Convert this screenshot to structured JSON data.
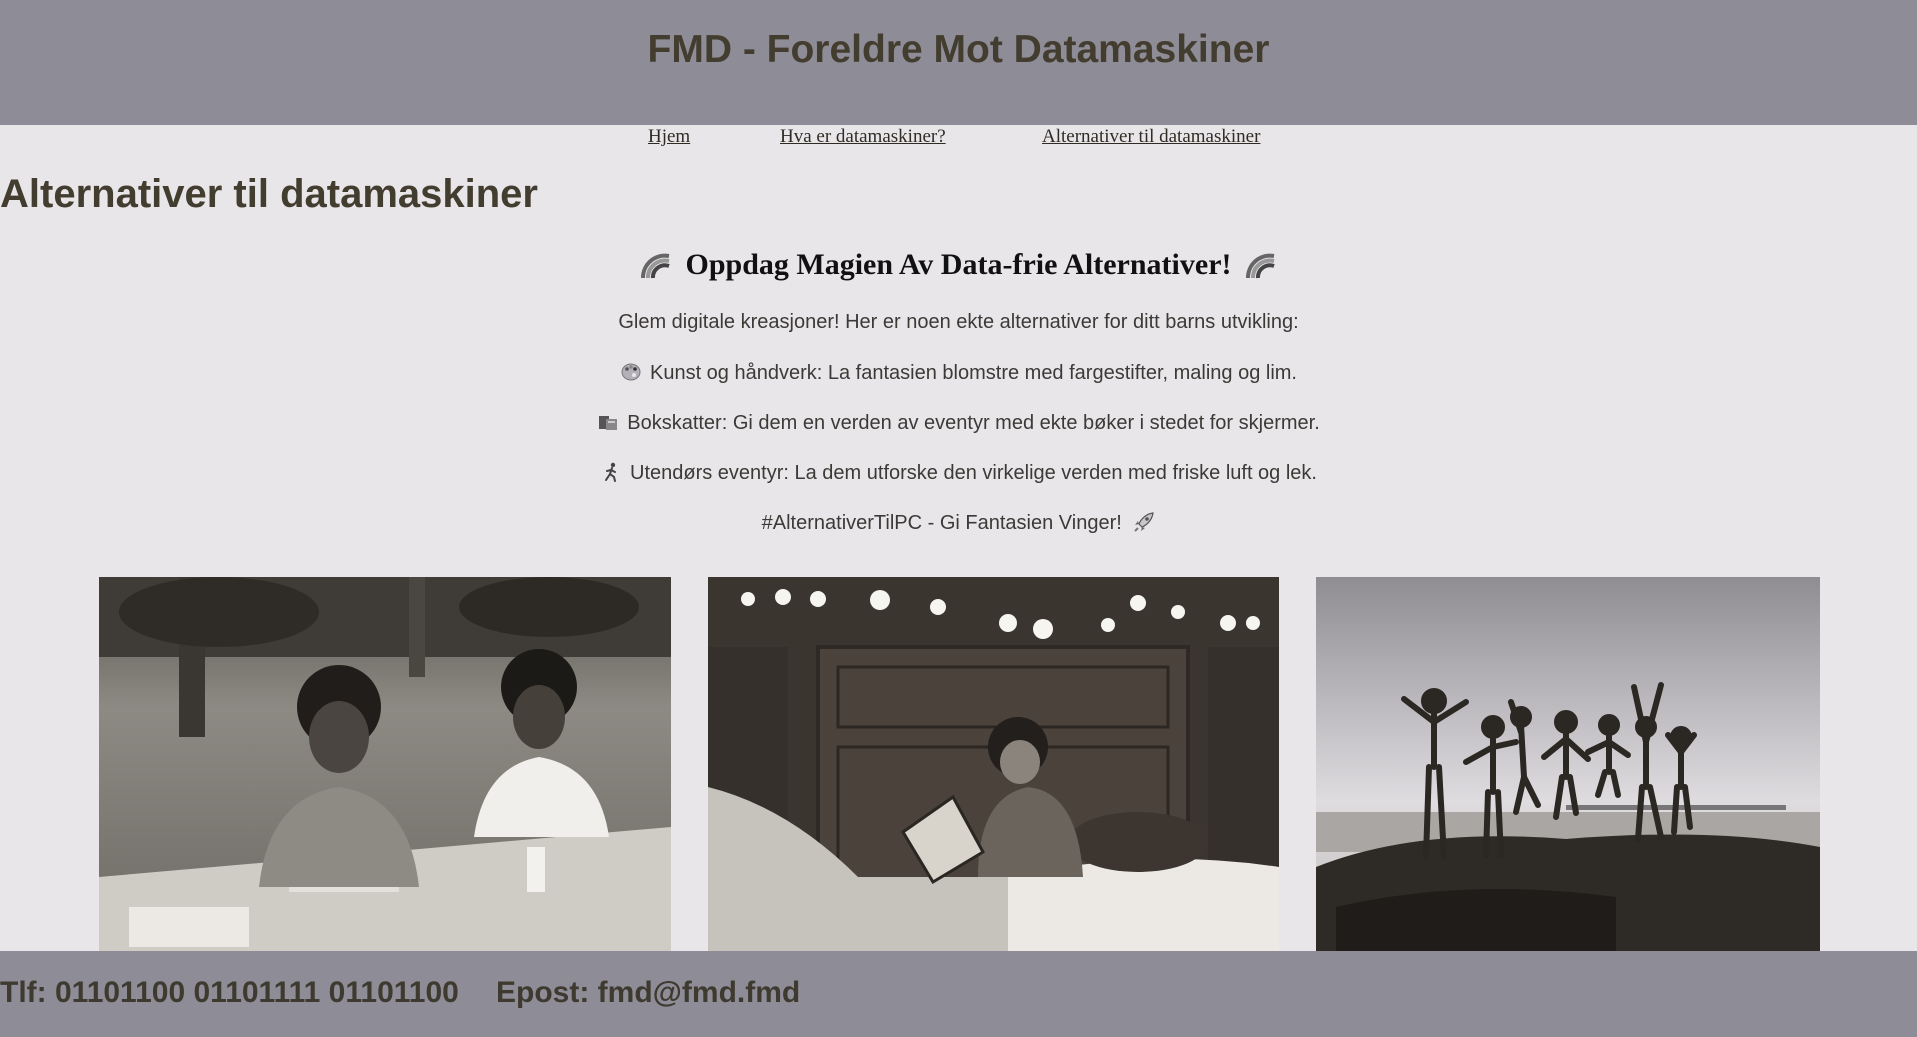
{
  "header": {
    "title": "FMD - Foreldre Mot Datamaskiner"
  },
  "nav": {
    "items": [
      {
        "label": "Hjem"
      },
      {
        "label": "Hva er datamaskiner?"
      },
      {
        "label": "Alternativer til datamaskiner"
      }
    ]
  },
  "main": {
    "heading": "Alternativer til datamaskiner",
    "promo": {
      "title": "Oppdag Magien Av Data-frie Alternativer!",
      "title_icon": "rainbow-icon",
      "intro": "Glem digitale kreasjoner! Her er noen ekte alternativer for ditt barns utvikling:",
      "items": [
        {
          "icon": "palette-icon",
          "text": "Kunst og håndverk: La fantasien blomstre med fargestifter, maling og lim."
        },
        {
          "icon": "books-icon",
          "text": "Bokskatter: Gi dem en verden av eventyr med ekte bøker i stedet for skjermer."
        },
        {
          "icon": "running-person-icon",
          "text": "Utendørs eventyr: La dem utforske den virkelige verden med friske luft og lek."
        }
      ],
      "tagline": "#AlternativerTilPC - Gi Fantasien Vinger!",
      "tagline_icon": "rocket-icon"
    },
    "photos": [
      {
        "name": "children-drawing-photo"
      },
      {
        "name": "child-reading-photo"
      },
      {
        "name": "children-jumping-photo"
      }
    ]
  },
  "footer": {
    "phone": "Tlf: 01101100 01101111 01101100",
    "email": "Epost: fmd@fmd.fmd"
  },
  "colors": {
    "header_bg": "#8e8c96",
    "page_bg": "#e9e6ea",
    "heading_text": "#433d30"
  }
}
